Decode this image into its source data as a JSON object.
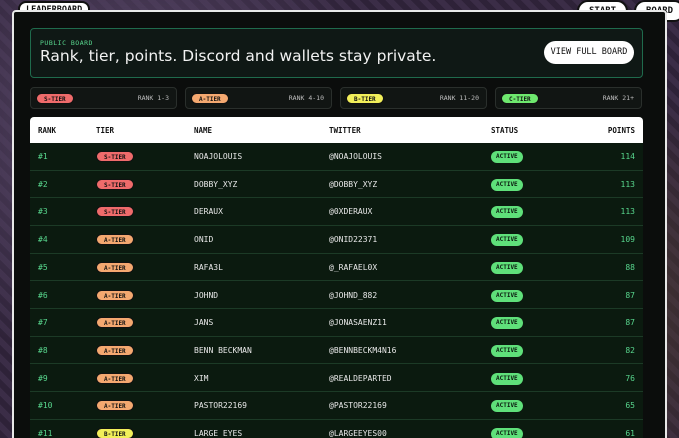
{
  "header": {
    "leaderboard_label": "LEADERBOARD",
    "start_label": "START",
    "board_label": "BOARD"
  },
  "banner": {
    "eyebrow": "PUBLIC BOARD",
    "title": "Rank, tier, points. Discord and wallets stay private.",
    "button": "VIEW FULL BOARD"
  },
  "tiers": [
    {
      "label": "S-TIER",
      "range": "RANK 1-3",
      "color": "#ef6b6b"
    },
    {
      "label": "A-TIER",
      "range": "RANK 4-10",
      "color": "#f4a870"
    },
    {
      "label": "B-TIER",
      "range": "RANK 11-20",
      "color": "#f2ef5a"
    },
    {
      "label": "C-TIER",
      "range": "RANK 21+",
      "color": "#6ee86e"
    }
  ],
  "table": {
    "columns": {
      "rank": "RANK",
      "tier": "TIER",
      "name": "NAME",
      "twitter": "TWITTER",
      "status": "STATUS",
      "points": "POINTS"
    },
    "rows": [
      {
        "rank": "#1",
        "tier": "S-TIER",
        "name": "NOAJOLOUIS",
        "twitter": "@NOAJOLOUIS",
        "status": "ACTIVE",
        "points": "114"
      },
      {
        "rank": "#2",
        "tier": "S-TIER",
        "name": "DOBBY_XYZ",
        "twitter": "@DOBBY_XYZ",
        "status": "ACTIVE",
        "points": "113"
      },
      {
        "rank": "#3",
        "tier": "S-TIER",
        "name": "DERAUX",
        "twitter": "@0XDERAUX",
        "status": "ACTIVE",
        "points": "113"
      },
      {
        "rank": "#4",
        "tier": "A-TIER",
        "name": "ONID",
        "twitter": "@ONID22371",
        "status": "ACTIVE",
        "points": "109"
      },
      {
        "rank": "#5",
        "tier": "A-TIER",
        "name": "RAFA3L",
        "twitter": "@_RAFAEL0X",
        "status": "ACTIVE",
        "points": "88"
      },
      {
        "rank": "#6",
        "tier": "A-TIER",
        "name": "JOHND",
        "twitter": "@JOHND_882",
        "status": "ACTIVE",
        "points": "87"
      },
      {
        "rank": "#7",
        "tier": "A-TIER",
        "name": "JANS",
        "twitter": "@JONASAENZ11",
        "status": "ACTIVE",
        "points": "87"
      },
      {
        "rank": "#8",
        "tier": "A-TIER",
        "name": "BENN BECKMAN",
        "twitter": "@BENNBECKM4N16",
        "status": "ACTIVE",
        "points": "82"
      },
      {
        "rank": "#9",
        "tier": "A-TIER",
        "name": "XIM",
        "twitter": "@REALDEPARTED",
        "status": "ACTIVE",
        "points": "76"
      },
      {
        "rank": "#10",
        "tier": "A-TIER",
        "name": "PASTOR22169",
        "twitter": "@PASTOR22169",
        "status": "ACTIVE",
        "points": "65"
      },
      {
        "rank": "#11",
        "tier": "B-TIER",
        "name": "LARGE EYES",
        "twitter": "@LARGEEYES00",
        "status": "ACTIVE",
        "points": "61"
      }
    ]
  }
}
